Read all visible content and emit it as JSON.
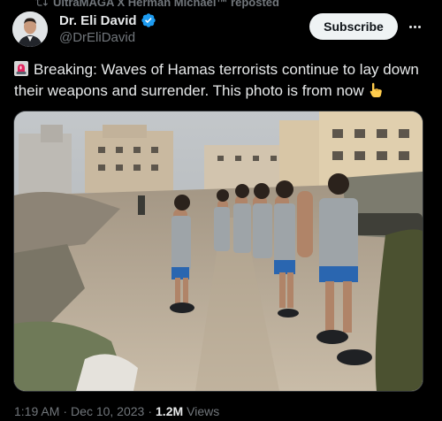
{
  "repost": {
    "text": "UltraMAGA X Herman Michael™ reposted"
  },
  "author": {
    "name": "Dr. Eli David",
    "handle": "@DrEliDavid"
  },
  "actions": {
    "subscribe_label": "Subscribe"
  },
  "tweet": {
    "line1": "Breaking: Waves of Hamas terrorists continue to lay down",
    "line2": "their weapons and surrender. This photo is from now"
  },
  "meta": {
    "time": "1:19 AM",
    "separator": "·",
    "date": "Dec 10, 2023",
    "views_count": "1.2M",
    "views_label": "Views"
  },
  "colors": {
    "background": "#000000",
    "text": "#e7e9ea",
    "secondary": "#71767b",
    "verified": "#1d9bf0"
  }
}
